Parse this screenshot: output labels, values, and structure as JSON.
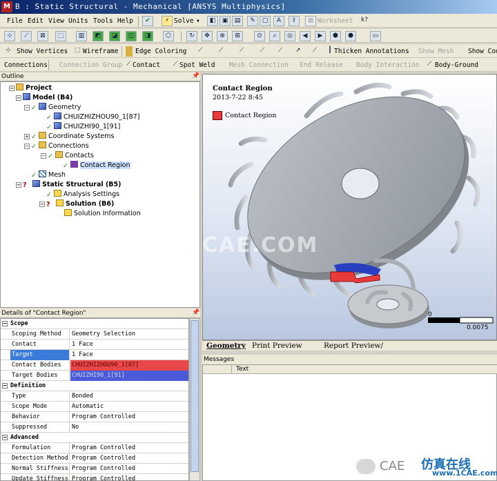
{
  "title_bar": {
    "text": "B : Static Structural - Mechanical [ANSYS Multiphysics]",
    "logo": "M"
  },
  "menu": [
    "File",
    "Edit",
    "View",
    "Units",
    "Tools",
    "Help"
  ],
  "toolbar1": {
    "solve": "Solve",
    "worksheet": "Worksheet"
  },
  "toolbar3": {
    "show_vertices": "Show Vertices",
    "wireframe": "Wireframe",
    "edge_coloring": "Edge Coloring",
    "thicken_annotations": "Thicken Annotations",
    "show_mesh": "Show Mesh",
    "show_coo": "Show Coo"
  },
  "toolbar4": {
    "connections": "Connections",
    "connection_group": "Connection Group",
    "contact": "Contact",
    "spot_weld": "Spot Weld",
    "mesh_connection": "Mesh Connection",
    "end_release": "End Release",
    "body_interaction": "Body Interaction",
    "body_ground": "Body-Ground"
  },
  "outline": {
    "header": "Outline",
    "items": [
      {
        "label": "Project",
        "level": 0,
        "icon": "project-icon"
      },
      {
        "label": "Model (B4)",
        "level": 1,
        "icon": "model-icon"
      },
      {
        "label": "Geometry",
        "level": 2,
        "icon": "geometry-icon"
      },
      {
        "label": "CHUIZHIZHOU90_1[87]",
        "level": 3,
        "icon": "body-icon"
      },
      {
        "label": "CHUIZHI90_1[91]",
        "level": 3,
        "icon": "body-icon"
      },
      {
        "label": "Coordinate Systems",
        "level": 2,
        "icon": "coordinate-systems-icon"
      },
      {
        "label": "Connections",
        "level": 2,
        "icon": "connections-icon"
      },
      {
        "label": "Contacts",
        "level": 3,
        "icon": "contacts-folder-icon"
      },
      {
        "label": "Contact Region",
        "level": 4,
        "icon": "contact-region-icon"
      },
      {
        "label": "Mesh",
        "level": 2,
        "icon": "mesh-icon"
      },
      {
        "label": "Static Structural (B5)",
        "level": 1,
        "icon": "static-structural-icon"
      },
      {
        "label": "Analysis Settings",
        "level": 2,
        "icon": "analysis-settings-icon"
      },
      {
        "label": "Solution (B6)",
        "level": 2,
        "icon": "solution-icon"
      },
      {
        "label": "Solution Information",
        "level": 3,
        "icon": "solution-information-icon"
      }
    ]
  },
  "details": {
    "header": "Details of \"Contact Region\"",
    "groups": [
      {
        "title": "Scope",
        "rows": [
          {
            "key": "Scoping Method",
            "value": "Geometry Selection"
          },
          {
            "key": "Contact",
            "value": "1 Face"
          },
          {
            "key": "Target",
            "value": "1 Face"
          },
          {
            "key": "Contact Bodies",
            "value": "CHUIZHIZHOU90_1[87]"
          },
          {
            "key": "Target Bodies",
            "value": "CHUIZHI90_1[91]"
          }
        ]
      },
      {
        "title": "Definition",
        "rows": [
          {
            "key": "Type",
            "value": "Bonded"
          },
          {
            "key": "Scope Mode",
            "value": "Automatic"
          },
          {
            "key": "Behavior",
            "value": "Program Controlled"
          },
          {
            "key": "Suppressed",
            "value": "No"
          }
        ]
      },
      {
        "title": "Advanced",
        "rows": [
          {
            "key": "Formulation",
            "value": "Program Controlled"
          },
          {
            "key": "Detection Method",
            "value": "Program Controlled"
          },
          {
            "key": "Normal Stiffness",
            "value": "Program Controlled"
          },
          {
            "key": "Update Stiffness",
            "value": "Program Controlled"
          }
        ]
      }
    ]
  },
  "graphics": {
    "title": "Contact Region",
    "date": "2013-7-22 8:45",
    "legend": "Contact Region",
    "scale_min": "0",
    "scale_max": "0.0075",
    "watermark": "1CAE.COM"
  },
  "tabs": [
    "Geometry",
    "Print Preview",
    "Report Preview/"
  ],
  "messages": {
    "header": "Messages",
    "col_text": "Text"
  },
  "brand": {
    "cae": "CAE",
    "cn": "仿真在线",
    "url": "www.1CAE.com"
  },
  "colors": {
    "contact": "#e83a3a",
    "target": "#4a5ad8",
    "selected_row": "#3a7ad8"
  }
}
